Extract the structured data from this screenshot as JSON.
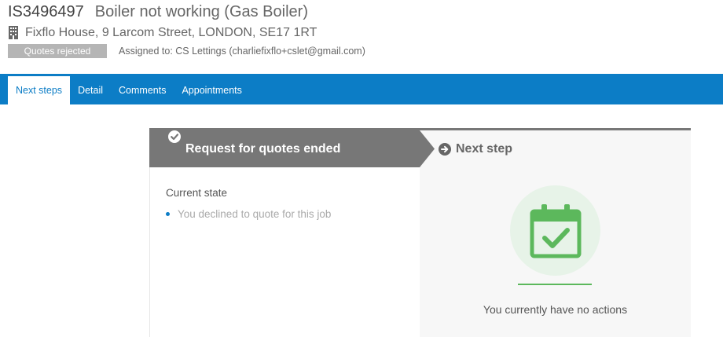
{
  "header": {
    "job_id": "IS3496497",
    "job_title": "Boiler not working (Gas Boiler)",
    "address": "Fixflo House, 9 Larcom Street, LONDON, SE17 1RT",
    "address_icon": "building-icon",
    "status": "Quotes rejected",
    "assigned": "Assigned to: CS Lettings (charliefixflo+cslet@gmail.com)"
  },
  "tabs": [
    {
      "label": "Next steps",
      "active": true
    },
    {
      "label": "Detail",
      "active": false
    },
    {
      "label": "Comments",
      "active": false
    },
    {
      "label": "Appointments",
      "active": false
    }
  ],
  "steps": {
    "active": {
      "label": "Request for quotes ended",
      "icon": "check-circle-icon"
    },
    "next": {
      "label": "Next step",
      "icon": "arrow-circle-right-icon"
    }
  },
  "current_state": {
    "heading": "Current state",
    "items": [
      "You declined to quote for this job"
    ]
  },
  "actions": {
    "icon": "calendar-check-icon",
    "empty_text": "You currently have no actions"
  },
  "colors": {
    "nav": "#0c7dc6",
    "step_active": "#777777",
    "success": "#5cb85c",
    "badge": "#b5b5b5"
  }
}
